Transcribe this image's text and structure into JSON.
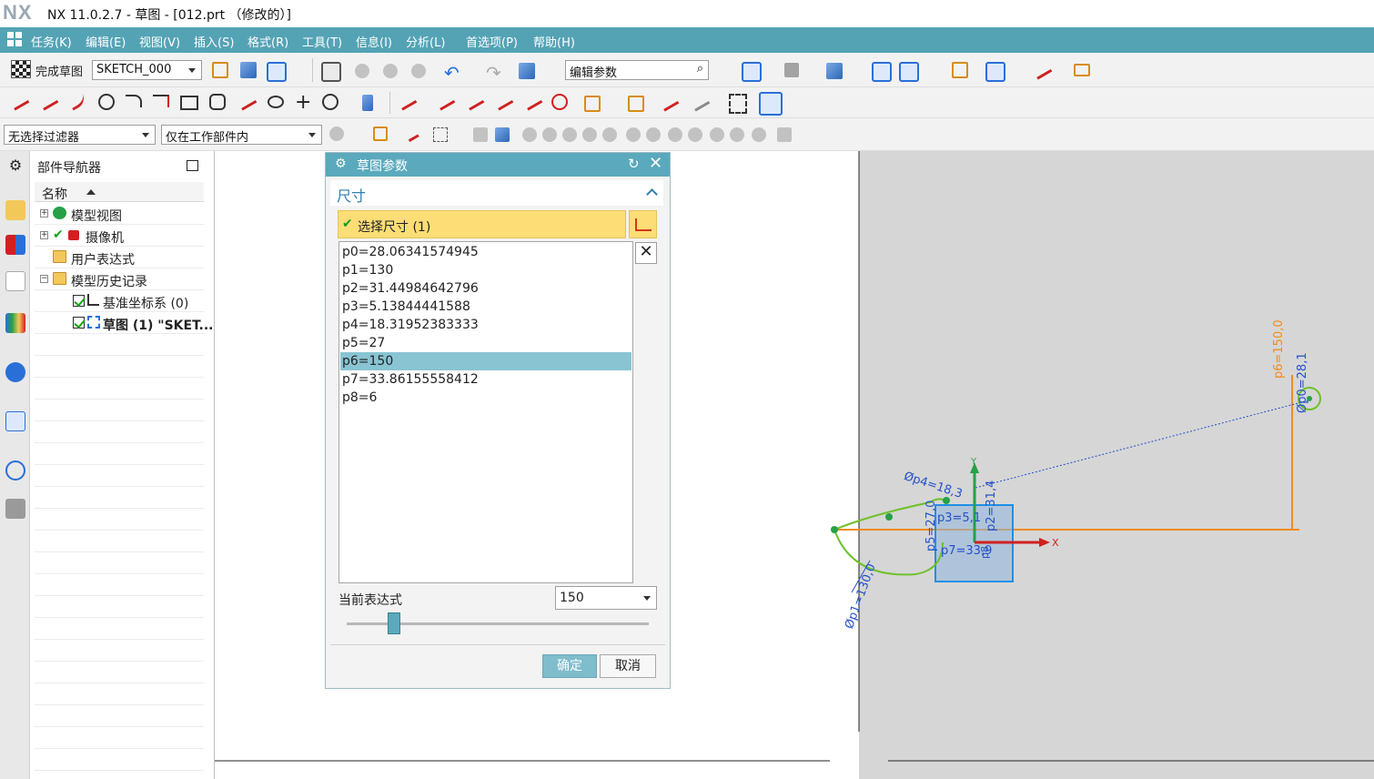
{
  "app": {
    "logo": "NX",
    "title": "NX 11.0.2.7 - 草图 - [012.prt （修改的）]"
  },
  "menu": [
    "任务(K)",
    "编辑(E)",
    "视图(V)",
    "插入(S)",
    "格式(R)",
    "工具(T)",
    "信息(I)",
    "分析(L)",
    "首选项(P)",
    "帮助(H)"
  ],
  "toolbar1": {
    "finish_sketch": "完成草图",
    "sketch_name": "SKETCH_000",
    "search_text": "编辑参数"
  },
  "toolbar3": {
    "selection_filter": "无选择过滤器",
    "scope": "仅在工作部件内"
  },
  "navigator": {
    "title": "部件导航器",
    "column": "名称",
    "items": [
      {
        "label": "模型视图",
        "expandable": true,
        "icon": "model-view-icon"
      },
      {
        "label": "摄像机",
        "expandable": true,
        "icon": "camera-icon"
      },
      {
        "label": "用户表达式",
        "expandable": false,
        "icon": "folder-icon"
      },
      {
        "label": "模型历史记录",
        "expandable": true,
        "icon": "folder-icon"
      },
      {
        "label": "基准坐标系 (0)",
        "expandable": false,
        "icon": "datum-csys-icon"
      },
      {
        "label": "草图 (1) \"SKET...",
        "expandable": false,
        "icon": "sketch-icon"
      }
    ]
  },
  "dialog": {
    "title": "草图参数",
    "section": "尺寸",
    "select_label": "选择尺寸 (1)",
    "list": [
      "p0=28.06341574945",
      "p1=130",
      "p2=31.44984642796",
      "p3=5.13844441588",
      "p4=18.31952383333",
      "p5=27",
      "p6=150",
      "p7=33.86155558412",
      "p8=6"
    ],
    "selected_index": 6,
    "expression_label": "当前表达式",
    "expression_value": "150",
    "ok": "确定",
    "cancel": "取消"
  },
  "canvas": {
    "dimensions": [
      "p6=150,0",
      "Øp0=28,1",
      "Øp4=18,3",
      "Øp1=130,0",
      "p5=27,0",
      "p3=5,1",
      "p2=31,4",
      "p7=33,9",
      "p8"
    ],
    "axis_x": "X",
    "axis_y": "Y"
  },
  "colors": {
    "accent": "#54a3b5",
    "dialog_title": "#5ba9bc",
    "selection_row": "#fddd76",
    "list_selected": "#89c4d3",
    "sketch_green": "#6fc12a",
    "dimension_blue": "#2451c9",
    "orange_dim": "#f08c1e"
  }
}
